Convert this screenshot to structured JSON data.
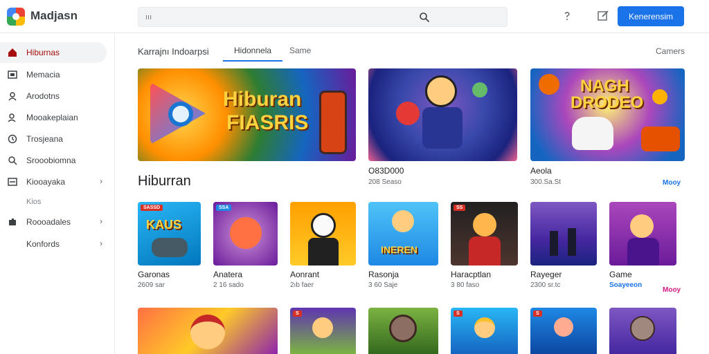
{
  "app": {
    "brand": "Madjasn"
  },
  "search": {
    "placeholder": "ııı"
  },
  "header": {
    "cta_label": "Kenerensim"
  },
  "sidebar": {
    "items": [
      {
        "label": "Hiburnas",
        "icon": "home-icon"
      },
      {
        "label": "Memacia",
        "icon": "media-icon"
      },
      {
        "label": "Arodotns",
        "icon": "gamepad-icon"
      },
      {
        "label": "Mooakeplaian",
        "icon": "person-icon"
      },
      {
        "label": "Trosjeana",
        "icon": "clock-icon"
      },
      {
        "label": "Srooobiomna",
        "icon": "search-icon"
      },
      {
        "label": "Kiooayaka",
        "icon": "folder-icon"
      },
      {
        "label": "Kios",
        "icon": ""
      },
      {
        "label": "Roooadales",
        "icon": "puzzle-icon"
      },
      {
        "label": "Konfords",
        "icon": ""
      }
    ]
  },
  "tabs": {
    "title": "Karrajnı Indoarpsi",
    "items": [
      "Hidonnela",
      "Same"
    ],
    "right": "Camers"
  },
  "banners": [
    {
      "headline_1": "Hiburan",
      "headline_2": "FIASRIS",
      "caption": "",
      "sub": ""
    },
    {
      "caption": "O83D000",
      "sub": "208 Seaso"
    },
    {
      "headline_1": "NAGH",
      "headline_2": "DRODEO",
      "caption": "Aeola",
      "sub": "300.Sa.St",
      "more": "Mooy"
    }
  ],
  "section": {
    "title": "Hiburran"
  },
  "row1": [
    {
      "title": "Garonas",
      "sub": "2609 sar",
      "badge": "SASSD",
      "art": "KAUS"
    },
    {
      "title": "Anatera",
      "sub": "2 16 sado",
      "badge": "SSA"
    },
    {
      "title": "Aonrant",
      "sub": "2ıb faer"
    },
    {
      "title": "Rasonja",
      "sub": "3 60 Saje",
      "art": "INEREN"
    },
    {
      "title": "Haracptlan",
      "sub": "3 80 faso",
      "badge": "SS"
    },
    {
      "title": "Rayeger",
      "sub": "2300 sr.tc"
    },
    {
      "title": "Game",
      "sub": "Soayeeon"
    }
  ],
  "row1_more": "Mooy",
  "colors": {
    "accent": "#1a73e8",
    "active_nav": "#a50e0e",
    "badge": "#d93025",
    "more_teal": "#1a73e8",
    "more_pink": "#d01884"
  }
}
